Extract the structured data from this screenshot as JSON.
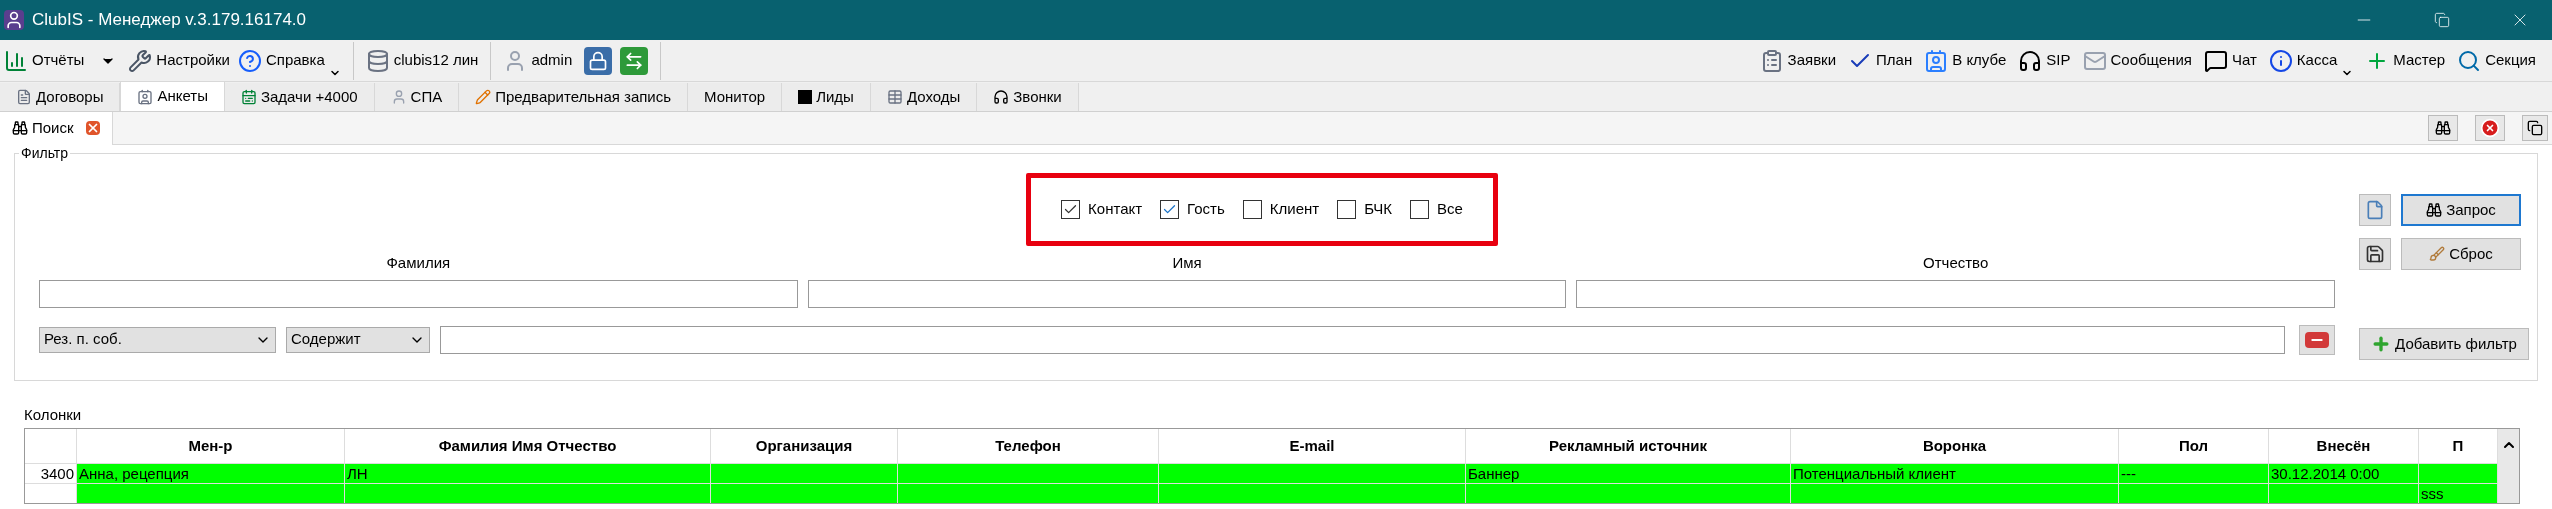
{
  "window": {
    "title": "ClubIS - Менеджер v.3.179.16174.0"
  },
  "toolbar_left": [
    {
      "label": "Отчёты",
      "dropdown": false,
      "split": true
    },
    {
      "label": "Настройки",
      "dropdown": false,
      "split": false
    },
    {
      "label": "Справка",
      "dropdown": true,
      "split": false
    },
    {
      "label": "clubis12 лин",
      "dropdown": false,
      "split": false
    },
    {
      "label": "admin",
      "dropdown": false,
      "split": false
    }
  ],
  "toolbar_right": [
    {
      "label": "Заявки",
      "dropdown": false
    },
    {
      "label": "План",
      "dropdown": false
    },
    {
      "label": "В клубе",
      "dropdown": false
    },
    {
      "label": "SIP",
      "dropdown": false
    },
    {
      "label": "Сообщения",
      "dropdown": false
    },
    {
      "label": "Чат",
      "dropdown": false
    },
    {
      "label": "Касса",
      "dropdown": true
    },
    {
      "label": "Мастер",
      "dropdown": false
    },
    {
      "label": "Секция",
      "dropdown": false
    }
  ],
  "tabs": [
    {
      "label": "Договоры",
      "selected": false
    },
    {
      "label": "Анкеты",
      "selected": true
    },
    {
      "label": "Задачи +4000",
      "selected": false
    },
    {
      "label": "СПА",
      "selected": false
    },
    {
      "label": "Предварительная запись",
      "selected": false
    },
    {
      "label": "Монитор",
      "selected": false
    },
    {
      "label": "Лиды",
      "selected": false
    },
    {
      "label": "Доходы",
      "selected": false
    },
    {
      "label": "Звонки",
      "selected": false
    }
  ],
  "subtabs": [
    {
      "label": "Поиск",
      "selected": true
    }
  ],
  "filter": {
    "title": "Фильтр",
    "checkboxes": [
      {
        "label": "Контакт",
        "checked": true
      },
      {
        "label": "Гость",
        "checked": true
      },
      {
        "label": "Клиент",
        "checked": false
      },
      {
        "label": "БЧК",
        "checked": false
      },
      {
        "label": "Все",
        "checked": false
      }
    ],
    "fields": [
      {
        "label": "Фамилия"
      },
      {
        "label": "Имя"
      },
      {
        "label": "Отчество"
      }
    ],
    "condition": {
      "field": "Рез. п. соб.",
      "operator": "Содержит"
    },
    "buttons": {
      "query": "Запрос",
      "reset": "Сброс",
      "add": "Добавить фильтр"
    }
  },
  "table": {
    "title": "Колонки",
    "columns": [
      "",
      "Мен-р",
      "Фамилия Имя Отчество",
      "Организация",
      "Телефон",
      "E-mail",
      "Рекламный источник",
      "Воронка",
      "Пол",
      "Внесён",
      "П"
    ],
    "rows": [
      {
        "color": "#00ff00",
        "cells": [
          "3400",
          "Анна, рецепция",
          "ЛН",
          "",
          "",
          "",
          "Баннер",
          "Потенциальный клиент",
          "---",
          "30.12.2014 0:00",
          ""
        ]
      },
      {
        "color": "#00ff00",
        "cells": [
          "",
          "",
          "",
          "",
          "",
          "",
          "",
          "",
          "",
          "",
          "sss"
        ]
      }
    ]
  }
}
